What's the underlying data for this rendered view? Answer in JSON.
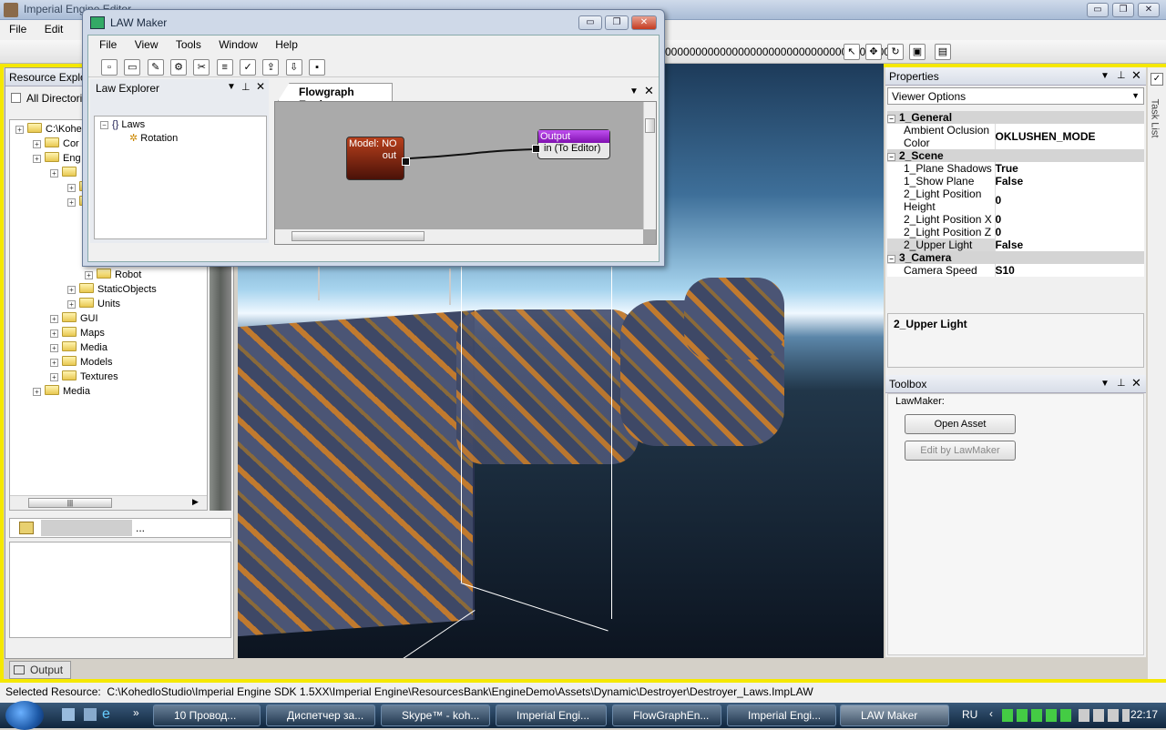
{
  "main_window": {
    "title": "Imperial Engine Editor",
    "menu": [
      "File",
      "Edit"
    ],
    "toolbar_text": "0000000000000000000000000000000000000",
    "controls": {
      "min": "▭",
      "max": "❐",
      "close": "✕"
    }
  },
  "resource_explorer": {
    "title": "Resource Explorer",
    "all_directories_label": "All Directories",
    "tree": [
      {
        "label": "C:\\Kohe",
        "indent": 0
      },
      {
        "label": "Cor",
        "indent": 1
      },
      {
        "label": "Eng",
        "indent": 1
      },
      {
        "label": "",
        "indent": 2
      },
      {
        "label": "",
        "indent": 3
      },
      {
        "label": "",
        "indent": 3
      }
    ],
    "tree_lower": [
      {
        "label": "Robot",
        "indent": 4
      },
      {
        "label": "StaticObjects",
        "indent": 3
      },
      {
        "label": "Units",
        "indent": 3
      },
      {
        "label": "GUI",
        "indent": 2
      },
      {
        "label": "Maps",
        "indent": 2
      },
      {
        "label": "Media",
        "indent": 2
      },
      {
        "label": "Models",
        "indent": 2
      },
      {
        "label": "Textures",
        "indent": 2
      },
      {
        "label": "Media",
        "indent": 1
      }
    ],
    "search_ellipsis": "..."
  },
  "law_maker": {
    "title": "LAW Maker",
    "menu": [
      "File",
      "View",
      "Tools",
      "Window",
      "Help"
    ],
    "explorer_title": "Law Explorer",
    "tree": {
      "root": "Laws",
      "child": "Rotation"
    },
    "tab": "Flowgraph Engine",
    "node_model": {
      "title": "Model: NO",
      "port": "out"
    },
    "node_output": {
      "title": "Output",
      "port": "in (To Editor)"
    }
  },
  "properties": {
    "title": "Properties",
    "dropdown": "Viewer Options",
    "categories": [
      {
        "name": "1_General",
        "rows": [
          {
            "k": "Ambient Oclusion Color",
            "v": "OKLUSHEN_MODE"
          }
        ]
      },
      {
        "name": "2_Scene",
        "rows": [
          {
            "k": "1_Plane Shadows",
            "v": "True"
          },
          {
            "k": "1_Show Plane",
            "v": "False"
          },
          {
            "k": "2_Light Position Height",
            "v": "0"
          },
          {
            "k": "2_Light Position X",
            "v": "0"
          },
          {
            "k": "2_Light Position Z",
            "v": "0"
          },
          {
            "k": "2_Upper Light",
            "v": "False"
          }
        ]
      },
      {
        "name": "3_Camera",
        "rows": [
          {
            "k": "Camera Speed",
            "v": "S10"
          }
        ]
      }
    ],
    "description": "2_Upper Light"
  },
  "toolbox": {
    "title": "Toolbox",
    "group": "LawMaker:",
    "open_asset": "Open Asset",
    "edit_by_lawmaker": "Edit by LawMaker"
  },
  "task_list_label": "Task List",
  "output_tab": "Output",
  "status": {
    "label": "Selected Resource:",
    "path": "C:\\KohedloStudio\\Imperial Engine SDK 1.5XX\\Imperial Engine\\ResourcesBank\\EngineDemo\\Assets\\Dynamic\\Destroyer\\Destroyer_Laws.ImpLAW"
  },
  "taskbar": {
    "items": [
      "10 Провод...",
      "Диспетчер за...",
      "Skype™ - koh...",
      "Imperial Engi...",
      "FlowGraphEn...",
      "Imperial Engi...",
      "LAW Maker"
    ],
    "lang": "RU",
    "clock": "22:17"
  },
  "colors": {
    "accent_yellow": "#f5e800",
    "node_red": "#9a2a10",
    "node_purple": "#a020d0"
  }
}
